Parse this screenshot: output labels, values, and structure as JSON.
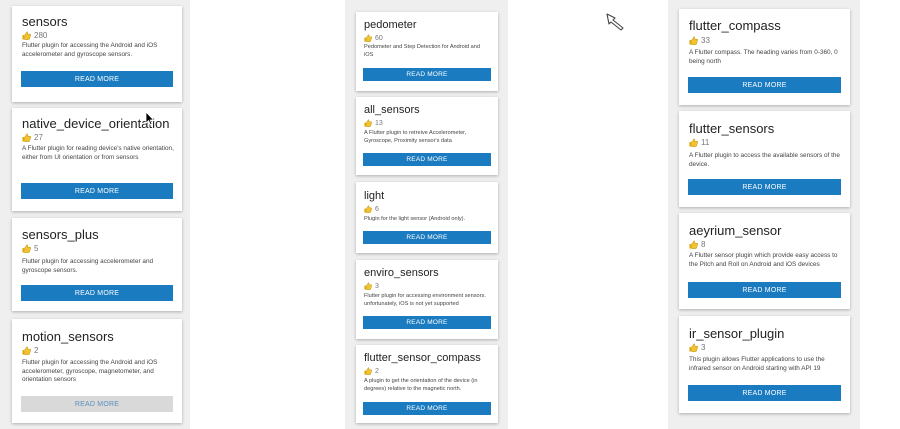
{
  "columns": [
    [
      {
        "name": "sensors",
        "likes": "280",
        "desc": "Flutter plugin for accessing the Android and iOS accelerometer and gyroscope sensors.",
        "button": "READ MORE"
      },
      {
        "name": "native_device_orientation",
        "likes": "27",
        "desc": "A Flutter plugin for reading device's native orientation, either from UI orientation or from sensors",
        "button": "READ MORE"
      },
      {
        "name": "sensors_plus",
        "likes": "5",
        "desc": "Flutter plugin for accessing accelerometer and gyroscope sensors.",
        "button": "READ MORE"
      },
      {
        "name": "motion_sensors",
        "likes": "2",
        "desc": "Flutter plugin for accessing the Android and iOS accelerometer, gyroscope, magnetometer, and orientation sensors",
        "button": "READ MORE"
      }
    ],
    [
      {
        "name": "pedometer",
        "likes": "60",
        "desc": "Pedometer and Step Detection for Android and iOS",
        "button": "READ MORE"
      },
      {
        "name": "all_sensors",
        "likes": "13",
        "desc": "A Flutter plugin to retreive Accelerometer, Gyroscope, Proximity sensor's data",
        "button": "READ MORE"
      },
      {
        "name": "light",
        "likes": "6",
        "desc": "Plugin for the light sensor (Android only).",
        "button": "READ MORE"
      },
      {
        "name": "enviro_sensors",
        "likes": "3",
        "desc": "Flutter plugin for accessing environment sensors. unfortunately, iOS is not yet supported",
        "button": "READ MORE"
      },
      {
        "name": "flutter_sensor_compass",
        "likes": "2",
        "desc": "A plugin to get the orientation of the device (in degrees) relative to the magnetic north.",
        "button": "READ MORE"
      }
    ],
    [
      {
        "name": "flutter_compass",
        "likes": "33",
        "desc": "A Flutter compass. The heading varies from 0-360, 0 being north",
        "button": "READ MORE"
      },
      {
        "name": "flutter_sensors",
        "likes": "11",
        "desc": "A Flutter plugin to access the available sensors of the device.",
        "button": "READ MORE"
      },
      {
        "name": "aeyrium_sensor",
        "likes": "8",
        "desc": "A Flutter sensor plugin which provide easy access to the Pitch and Roll on Android and iOS devices",
        "button": "READ MORE"
      },
      {
        "name": "ir_sensor_plugin",
        "likes": "3",
        "desc": "This plugin allows Flutter applications to use the infrared sensor on Android starting with API 19",
        "button": "READ MORE"
      }
    ]
  ],
  "colors": {
    "button": "#1a7bc0",
    "button_hover": "#d9d9d9",
    "background": "#efefef"
  },
  "icons": {
    "likes": "thumbs-up-icon"
  }
}
